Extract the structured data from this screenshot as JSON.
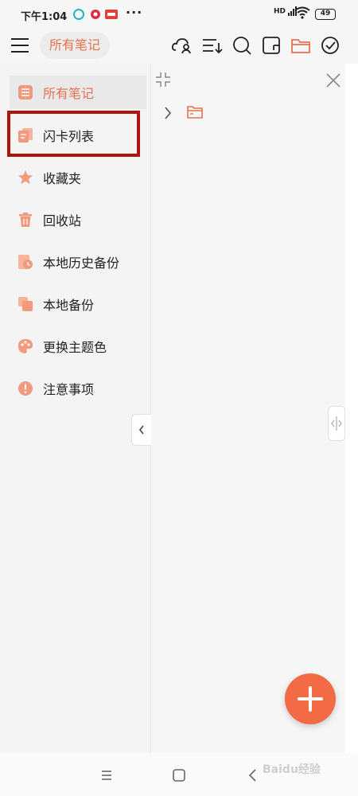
{
  "status_bar": {
    "time": "下午1:04",
    "more": "···",
    "signal": "HD",
    "battery": "49"
  },
  "toolbar": {
    "title": "所有笔记",
    "icons": [
      "menu-icon",
      "cloud-user-icon",
      "sort-icon",
      "search-icon",
      "wallet-icon",
      "folder-icon",
      "check-circle-icon"
    ]
  },
  "sidebar": {
    "items": [
      {
        "label": "所有笔记",
        "icon": "list-icon",
        "active": true
      },
      {
        "label": "闪卡列表",
        "icon": "flashcard-icon",
        "active": false
      },
      {
        "label": "收藏夹",
        "icon": "star-icon",
        "active": false
      },
      {
        "label": "回收站",
        "icon": "trash-icon",
        "active": false
      },
      {
        "label": "本地历史备份",
        "icon": "history-backup-icon",
        "active": false
      },
      {
        "label": "本地备份",
        "icon": "backup-icon",
        "active": false
      },
      {
        "label": "更换主题色",
        "icon": "palette-icon",
        "active": false
      },
      {
        "label": "注意事项",
        "icon": "alert-icon",
        "active": false
      }
    ]
  },
  "watermark": "Baidu经验",
  "colors": {
    "accent": "#e8704d",
    "fab": "#f26b45",
    "highlight": "#b0140f"
  }
}
